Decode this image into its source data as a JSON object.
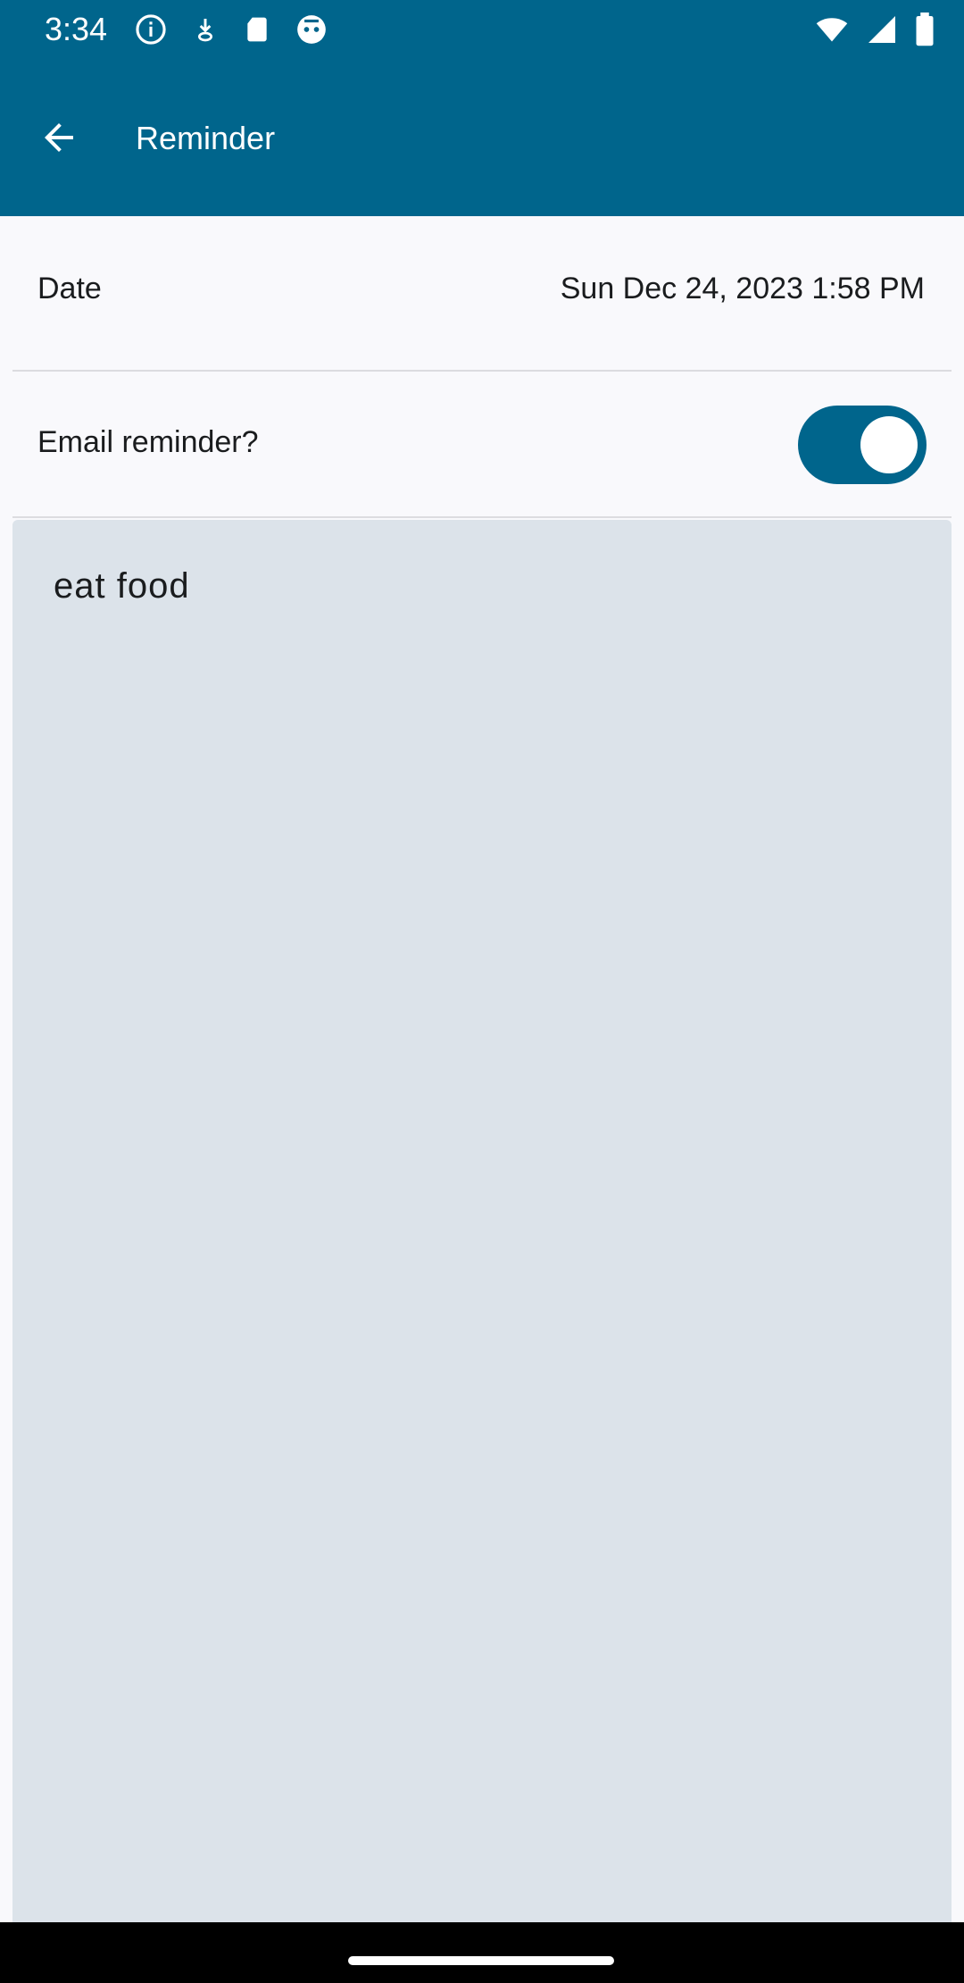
{
  "status_bar": {
    "time": "3:34",
    "left_icons": [
      "info-icon",
      "download-icon",
      "sd-card-icon",
      "robot-icon"
    ],
    "right_icons": [
      "wifi-icon",
      "cell-signal-icon",
      "battery-icon"
    ]
  },
  "app_bar": {
    "title": "Reminder",
    "back_icon": "arrow-back-icon"
  },
  "date_row": {
    "label": "Date",
    "value": "Sun Dec 24, 2023 1:58 PM"
  },
  "email_row": {
    "label": "Email reminder?",
    "toggle_on": true
  },
  "note": {
    "text": "eat food"
  },
  "colors": {
    "primary": "#00658c",
    "note_background": "#dce3ea",
    "surface": "#f9f9fc"
  }
}
